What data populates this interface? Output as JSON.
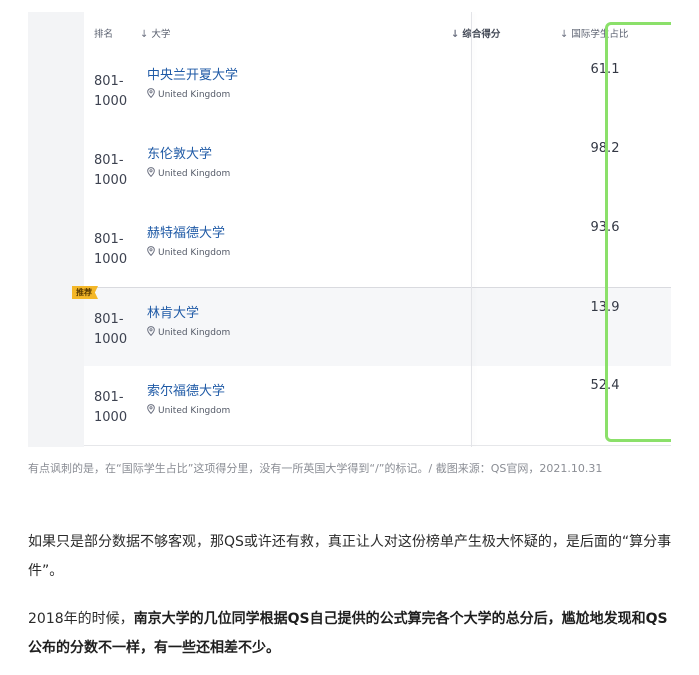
{
  "table": {
    "headers": {
      "rank": "排名",
      "university": "大学",
      "overall": "综合得分",
      "intl_ratio": "国际学生占比"
    },
    "rows": [
      {
        "rank_line1": "801-",
        "rank_line2": "1000",
        "name": "中央兰开夏大学",
        "location": "United Kingdom",
        "value": "61.1",
        "badge": ""
      },
      {
        "rank_line1": "801-",
        "rank_line2": "1000",
        "name": "东伦敦大学",
        "location": "United Kingdom",
        "value": "98.2",
        "badge": ""
      },
      {
        "rank_line1": "801-",
        "rank_line2": "1000",
        "name": "赫特福德大学",
        "location": "United Kingdom",
        "value": "93.6",
        "badge": ""
      },
      {
        "rank_line1": "801-",
        "rank_line2": "1000",
        "name": "林肯大学",
        "location": "United Kingdom",
        "value": "13.9",
        "badge": "推荐"
      },
      {
        "rank_line1": "801-",
        "rank_line2": "1000",
        "name": "索尔福德大学",
        "location": "United Kingdom",
        "value": "52.4",
        "badge": ""
      }
    ],
    "highlight_color": "#8be06a"
  },
  "caption": "有点讽刺的是，在“国际学生占比”这项得分里，没有一所英国大学得到“/”的标记。/ 截图来源：QS官网，2021.10.31",
  "article": {
    "p1": "如果只是部分数据不够客观，那QS或许还有救，真正让人对这份榜单产生极大怀疑的，是后面的“算分事件”。",
    "p2_prefix": "2018年的时候，",
    "p2_bold": "南京大学的几位同学根据QS自己提供的公式算完各个大学的总分后，尴尬地发现和QS公布的分数不一样，有一些还相差不少。"
  }
}
